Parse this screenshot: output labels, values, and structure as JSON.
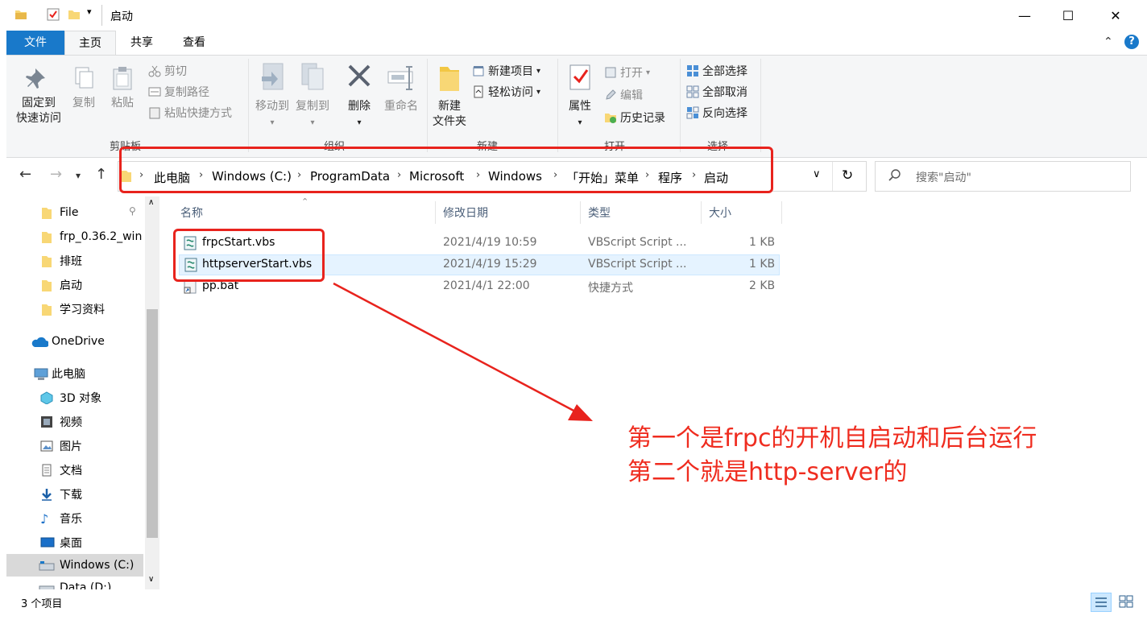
{
  "window": {
    "title": "启动",
    "minimize_glyph": "—",
    "maximize_glyph": "☐",
    "close_glyph": "✕"
  },
  "ribbon_tabs": [
    {
      "label": "文件"
    },
    {
      "label": "主页"
    },
    {
      "label": "共享"
    },
    {
      "label": "查看"
    }
  ],
  "ribbon": {
    "clipboard": {
      "group_label": "剪贴板",
      "pin_line1": "固定到",
      "pin_line2": "快速访问",
      "copy": "复制",
      "paste": "粘贴",
      "cut": "剪切",
      "copy_path": "复制路径",
      "paste_shortcut": "粘贴快捷方式"
    },
    "organize": {
      "group_label": "组织",
      "move_to": "移动到",
      "copy_to": "复制到",
      "delete": "删除",
      "rename": "重命名"
    },
    "new": {
      "group_label": "新建",
      "new_folder_line1": "新建",
      "new_folder_line2": "文件夹",
      "new_item": "新建项目",
      "easy_access": "轻松访问"
    },
    "open": {
      "group_label": "打开",
      "properties": "属性",
      "open": "打开",
      "edit": "编辑",
      "history": "历史记录"
    },
    "select": {
      "group_label": "选择",
      "select_all": "全部选择",
      "select_none": "全部取消",
      "invert": "反向选择"
    }
  },
  "address": {
    "crumbs": [
      "此电脑",
      "Windows (C:)",
      "ProgramData",
      "Microsoft",
      "Windows",
      "「开始」菜单",
      "程序",
      "启动"
    ]
  },
  "search": {
    "placeholder": "搜索\"启动\""
  },
  "nav_pane": {
    "quick_access": [
      {
        "label": "File",
        "pinned": true
      },
      {
        "label": "frp_0.36.2_win"
      },
      {
        "label": "排班"
      },
      {
        "label": "启动"
      },
      {
        "label": "学习资料"
      }
    ],
    "onedrive": "OneDrive",
    "this_pc": "此电脑",
    "pc_items": [
      {
        "label": "3D 对象",
        "icon": "3d-objects-icon"
      },
      {
        "label": "视频",
        "icon": "video-icon"
      },
      {
        "label": "图片",
        "icon": "pictures-icon"
      },
      {
        "label": "文档",
        "icon": "documents-icon"
      },
      {
        "label": "下载",
        "icon": "downloads-icon"
      },
      {
        "label": "音乐",
        "icon": "music-icon"
      },
      {
        "label": "桌面",
        "icon": "desktop-icon"
      },
      {
        "label": "Windows (C:)",
        "icon": "drive-icon",
        "selected": true
      },
      {
        "label": "Data (D:)",
        "icon": "drive-icon"
      }
    ]
  },
  "file_list": {
    "columns": [
      "名称",
      "修改日期",
      "类型",
      "大小"
    ],
    "rows": [
      {
        "name": "frpcStart.vbs",
        "date": "2021/4/19 10:59",
        "type": "VBScript Script ...",
        "size": "1 KB",
        "icon": "vbs-script-icon"
      },
      {
        "name": "httpserverStart.vbs",
        "date": "2021/4/19 15:29",
        "type": "VBScript Script ...",
        "size": "1 KB",
        "icon": "vbs-script-icon",
        "hovered": true
      },
      {
        "name": "pp.bat",
        "date": "2021/4/1 22:00",
        "type": "快捷方式",
        "size": "2 KB",
        "icon": "shortcut-icon"
      }
    ]
  },
  "status_bar": {
    "item_count": "3 个项目"
  },
  "annotation": {
    "line1": "第一个是frpc的开机自启动和后台运行",
    "line2": "第二个就是http-server的",
    "color": "#ef2c1f"
  }
}
